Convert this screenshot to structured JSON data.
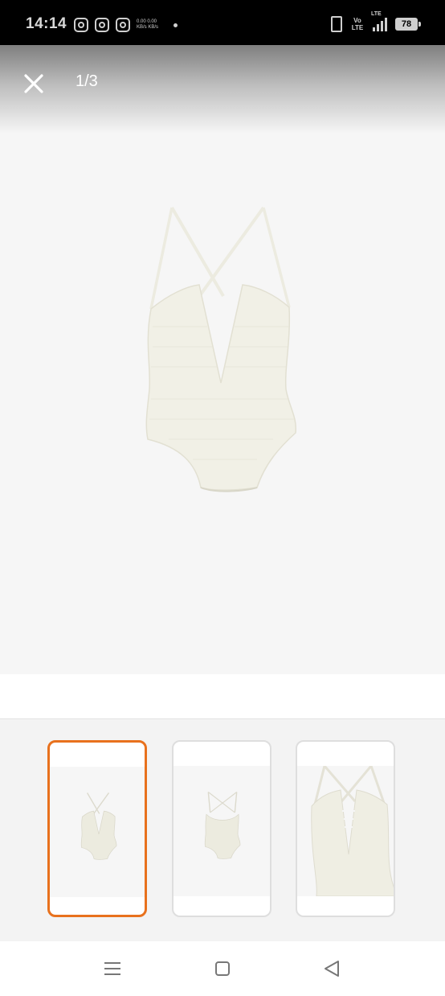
{
  "status_bar": {
    "time": "14:14",
    "notification_icons": [
      "instagram-icon",
      "instagram-icon",
      "instagram-icon"
    ],
    "network_speed": "0.00 0.00 KB/s KB/s",
    "volte_label": "Vo LTE",
    "network_type": "LTE",
    "battery_level": "78"
  },
  "viewer": {
    "page_counter": "1/3",
    "close_icon": "close-icon",
    "background_color": "#f6f6f6",
    "product_color": "#f1f0e6"
  },
  "thumbnails": {
    "selected_index": 0,
    "accent_color": "#e8711d",
    "items": [
      {
        "name": "front-view"
      },
      {
        "name": "back-view"
      },
      {
        "name": "detail-closeup"
      }
    ]
  },
  "nav_bar": {
    "icons": [
      "menu-icon",
      "home-square-icon",
      "back-triangle-icon"
    ]
  }
}
